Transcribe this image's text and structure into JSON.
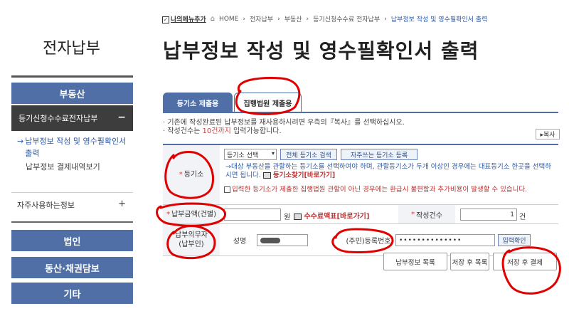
{
  "sidebar": {
    "title": "전자납부",
    "categories": [
      "부동산",
      "법인",
      "동산·채권담보",
      "기타"
    ],
    "active_sub": "등기신청수수료전자납부",
    "active_sub_toggle": "−",
    "sub_items": [
      "납부정보 작성 및 영수필확인서 출력",
      "납부정보 결제내역보기"
    ],
    "frequent": "자주사용하는정보",
    "frequent_toggle": "+"
  },
  "header": {
    "my_menu": "나의메뉴추가",
    "breadcrumb": [
      "HOME",
      "전자납부",
      "부동산",
      "등기신청수수료 전자납부",
      "납부정보 작성 및 영수필확인서 출력"
    ],
    "title": "납부정보 작성 및 영수필확인서 출력"
  },
  "tabs": [
    "등기소 제출용",
    "집행법원 제출용"
  ],
  "notes": {
    "line1": "· 기존에 작성완료된 납부정보를 재사용하시려면 우측의『복사』를 선택하십시오.",
    "line2_pre": "· 작성건수는 ",
    "line2_hl": "10건까지",
    "line2_post": " 입력가능합니다.",
    "copy_button": "▸복사"
  },
  "form": {
    "registry_label": "등기소",
    "registry_select": "등기소 선택",
    "btn_all_registry": "전체 등기소 검색",
    "btn_frequent_registry": "자주쓰는 등기소 등록",
    "info_text": "→대상 부동산을 관할하는 등기소를 선택하여야 하며, 관할등기소가 두개 이상인 경우에는 대표등기소 한곳을 선택하시면 됩니다.",
    "registry_link": "등기소찾기[바로가기]",
    "warning": "입력한 등기소가 제출한 집행법원 관할이 아닌 경우에는 환급시 불편함과 추가비용이 발생할 수 있습니다.",
    "amount_label": "납부금액(건별)",
    "amount_unit": "원",
    "fee_link": "수수료액표[바로가기]",
    "count_label": "작성건수",
    "count_value": "1",
    "count_unit": "건",
    "payer_label_1": "납부의무자",
    "payer_label_2": "(납부인)",
    "name_label": "성명",
    "reg_label": "(주민)등록번호",
    "reg_value": "••••••••••••••",
    "verify_button": "입력확인"
  },
  "actions": [
    "납부정보 목록",
    "저장 후 목록",
    "저장 후 결제"
  ],
  "colors": {
    "accent": "#4f6fa6",
    "dark": "#3d3d3d",
    "red": "#d04040"
  }
}
